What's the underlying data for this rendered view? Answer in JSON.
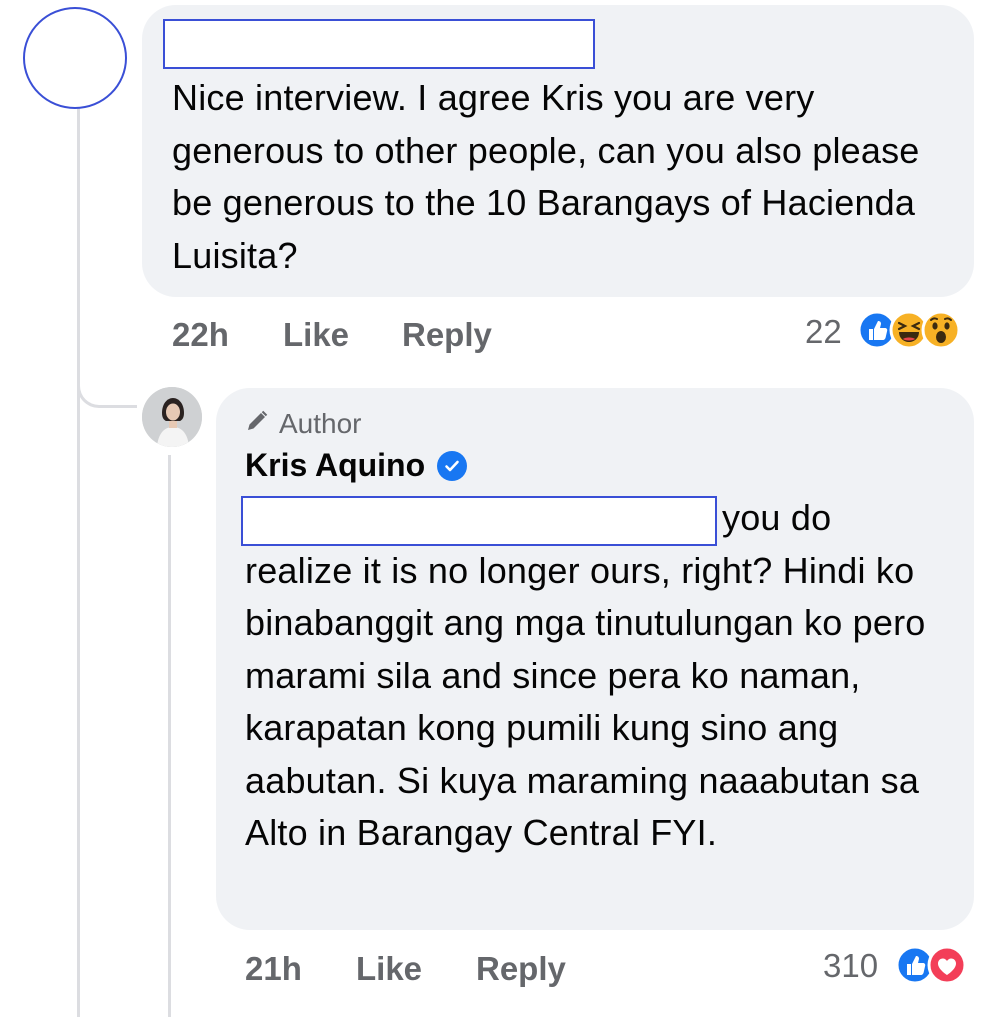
{
  "comment": {
    "text": "Nice interview. I agree Kris you are very generous to other people, can you also please be generous to the 10 Barangays of Hacienda Luisita?",
    "time": "22h",
    "like_label": "Like",
    "reply_label": "Reply",
    "reaction_count": "22",
    "reactions": [
      "like-reaction-icon",
      "haha-reaction-icon",
      "wow-reaction-icon"
    ]
  },
  "reply": {
    "badge": "Author",
    "author_name": "Kris Aquino",
    "text_lead": "you do",
    "text_rest": "realize it is no longer ours, right? Hindi ko binabanggit ang mga tinutulungan ko pero marami sila and since pera ko naman, karapatan kong pumili kung sino ang aabutan. Si kuya maraming naaabutan sa Alto in Barangay Central FYI.",
    "time": "21h",
    "like_label": "Like",
    "reply_label": "Reply",
    "reaction_count": "310",
    "reactions": [
      "like-reaction-icon",
      "love-reaction-icon"
    ]
  },
  "colors": {
    "bubble": "#f0f2f5",
    "meta_text": "#65676b",
    "like_blue": "#1877f2",
    "love_red": "#f33e58",
    "redaction_border": "#3a4fd6"
  }
}
